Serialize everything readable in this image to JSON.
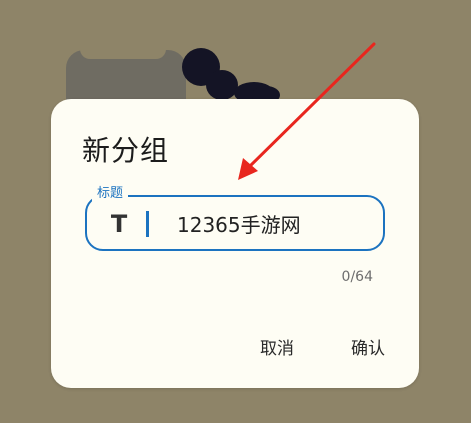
{
  "dialog": {
    "title": "新分组",
    "field_label": "标题",
    "field_value": "12365手游网",
    "char_counter": "0/64",
    "cancel_label": "取消",
    "confirm_label": "确认"
  },
  "icons": {
    "text_field_icon": "text-format-icon",
    "annotation": "red-arrow-icon"
  },
  "colors": {
    "accent": "#1c73c0",
    "dialog_bg": "#fefdf4",
    "page_bg": "#8e8468",
    "annotation": "#e8261e"
  }
}
